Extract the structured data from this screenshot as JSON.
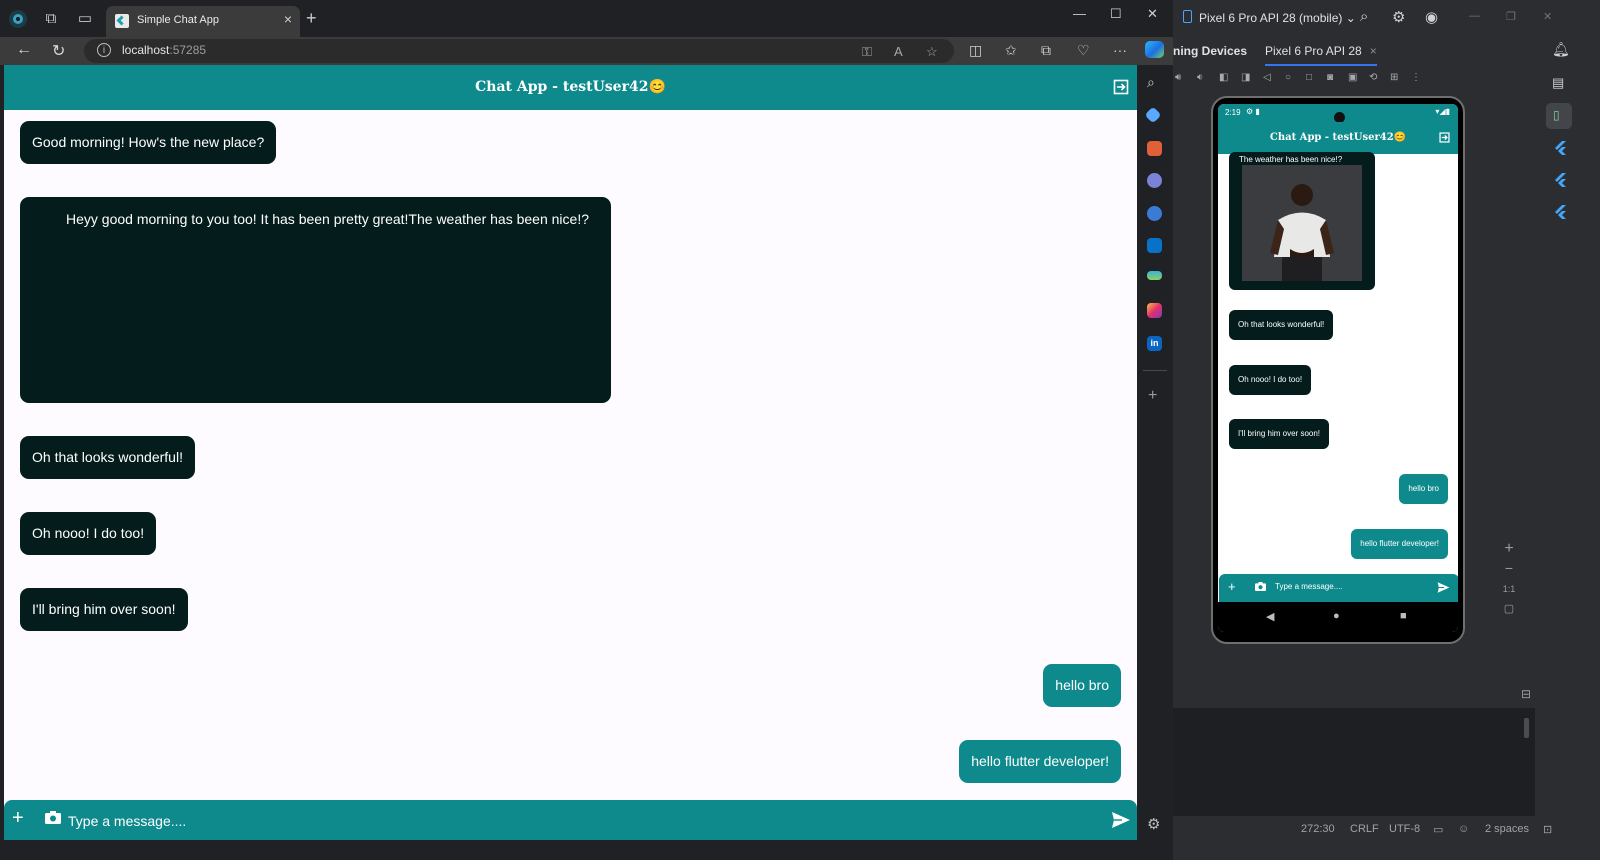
{
  "browser": {
    "tab_title": "Simple Chat App",
    "tab_close": "×",
    "new_tab": "+",
    "address_host": "localhost",
    "address_port": ":57285"
  },
  "chat": {
    "title": "Chat App - testUser42",
    "messages": [
      {
        "text": "Good morning! How's the new place?",
        "side": "left"
      },
      {
        "text": "Heyy good morning to you too! It has been pretty great!The weather has been nice!?",
        "side": "left",
        "image": true
      },
      {
        "text": "Oh that looks wonderful!",
        "side": "left"
      },
      {
        "text": "Oh nooo! I do too!",
        "side": "left"
      },
      {
        "text": "I'll bring him over soon!",
        "side": "left"
      },
      {
        "text": "hello bro",
        "side": "right"
      },
      {
        "text": "hello flutter developer!",
        "side": "right"
      }
    ],
    "composer": {
      "placeholder": "Type a message...."
    }
  },
  "studio": {
    "device_selector": "Pixel 6 Pro API 28 (mobile)",
    "running_devices_title": "ning Devices",
    "device_tab": "Pixel 6 Pro API 28",
    "device_tab_close": "×",
    "phone": {
      "status_time": "2:19",
      "title": "Chat App - testUser42",
      "image_caption": "The weather has been nice!?",
      "messages": [
        "Oh that looks wonderful!",
        "Oh nooo! I do too!",
        "I'll bring him over soon!",
        "hello bro",
        "hello flutter developer!"
      ],
      "composer_placeholder": "Type a message...."
    },
    "zoom_ratio": "1:1",
    "status_bar": {
      "position": "272:30",
      "line_endings": "CRLF",
      "encoding": "UTF-8",
      "indent": "2 spaces"
    }
  },
  "colors": {
    "teal": "#0e8a8d",
    "dark_bubble": "#041c1c",
    "page_bg": "#fdfbff"
  },
  "icons": {
    "emoji": "😊"
  }
}
